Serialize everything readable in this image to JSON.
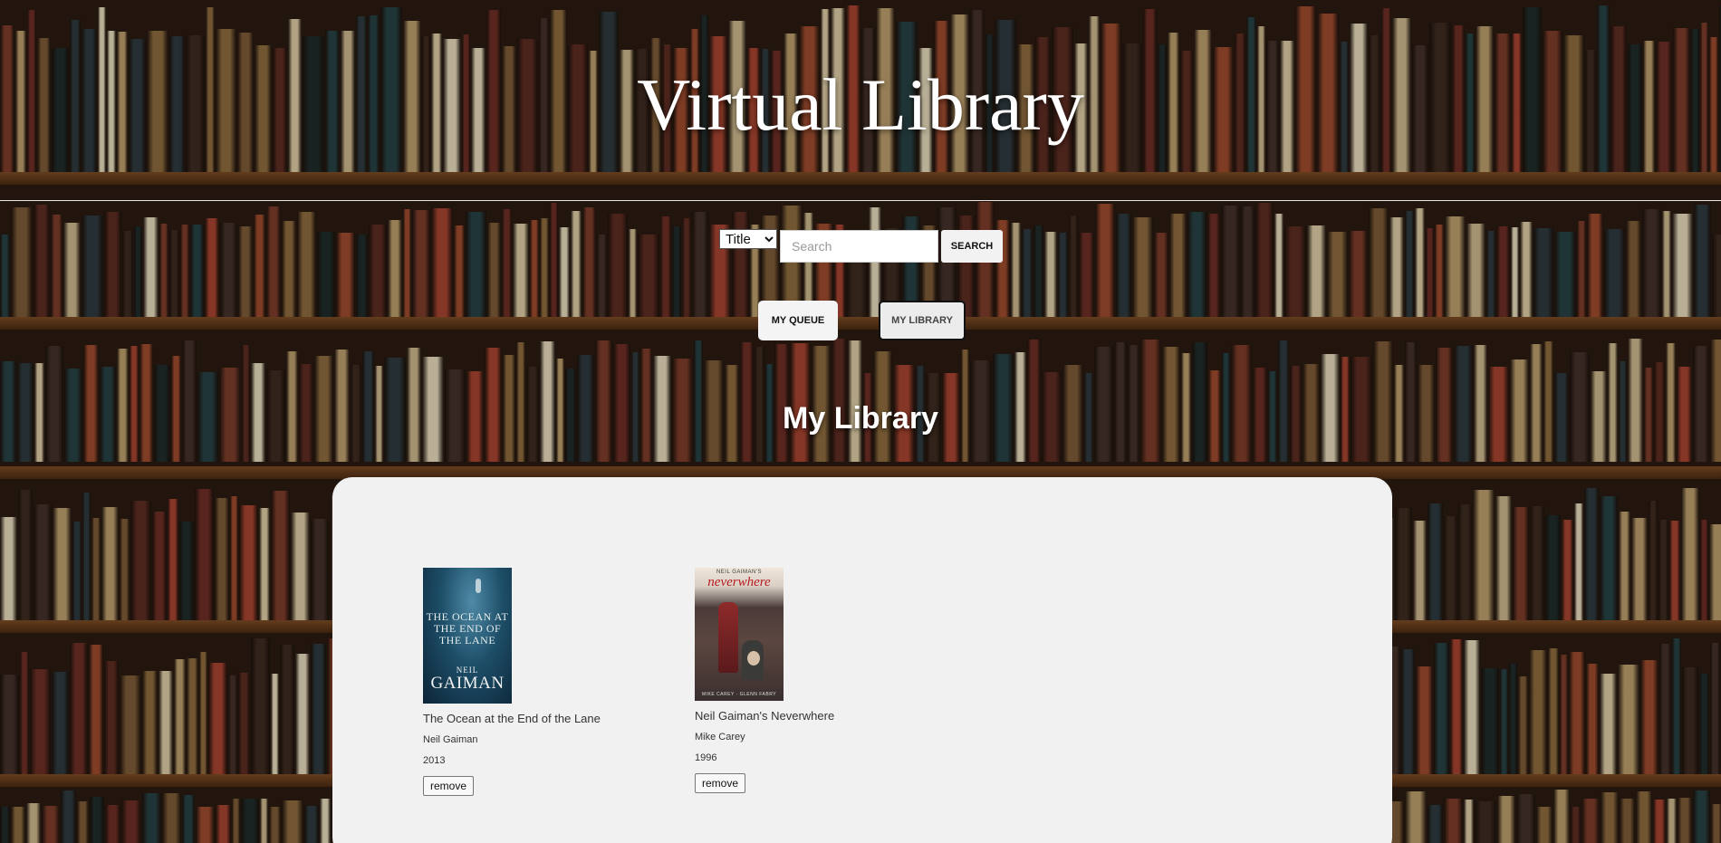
{
  "header": {
    "title": "Virtual Library"
  },
  "search": {
    "type_selected": "Title",
    "type_options": [
      "Title"
    ],
    "placeholder": "Search",
    "button_label": "SEARCH"
  },
  "nav": {
    "queue_label": "MY QUEUE",
    "library_label": "MY LIBRARY"
  },
  "library": {
    "heading": "My Library",
    "remove_label": "remove",
    "books": [
      {
        "title": "The Ocean at the End of the Lane",
        "author": "Neil Gaiman",
        "year": "2013",
        "cover": {
          "text_title": "THE OCEAN AT THE END OF THE LANE",
          "text_author_first": "NEIL",
          "text_author_last": "GAIMAN"
        }
      },
      {
        "title": "Neil Gaiman's Neverwhere",
        "author": "Mike Carey",
        "year": "1996",
        "cover": {
          "text_small": "NEIL GAIMAN'S",
          "text_big": "neverwhere",
          "text_credit": "MIKE CAREY · GLENN FABRY"
        }
      }
    ]
  },
  "colors": {
    "panel_bg": "#f1f1f1",
    "title_text": "#ffffff",
    "shelf_wood": "#7a4a24"
  }
}
